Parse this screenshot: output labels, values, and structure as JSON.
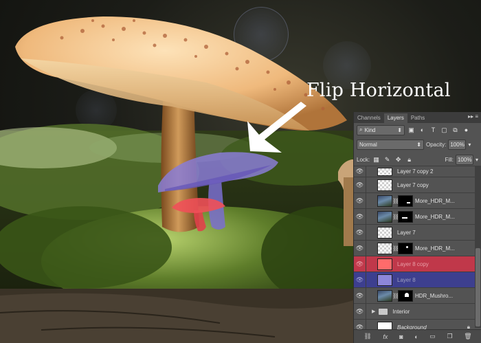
{
  "annotation": {
    "text": "Flip Horizontal"
  },
  "panel": {
    "tabs": [
      {
        "label": "Channels",
        "active": false
      },
      {
        "label": "Layers",
        "active": true
      },
      {
        "label": "Paths",
        "active": false
      }
    ],
    "filter": {
      "kind_label": "Kind"
    },
    "blend": {
      "mode": "Normal",
      "opacity_label": "Opacity:",
      "opacity_value": "100%"
    },
    "lock": {
      "label": "Lock:",
      "fill_label": "Fill:",
      "fill_value": "100%"
    },
    "layers": [
      {
        "name": "Layer 7 copy 2",
        "thumb": "checker",
        "mask": false,
        "style": "normal"
      },
      {
        "name": "Layer 7 copy",
        "thumb": "checker",
        "mask": false,
        "style": "normal"
      },
      {
        "name": "More_HDR_M...",
        "thumb": "photo",
        "mask": true,
        "style": "normal"
      },
      {
        "name": "More_HDR_M...",
        "thumb": "photo",
        "mask": true,
        "style": "normal"
      },
      {
        "name": "Layer 7",
        "thumb": "checker",
        "mask": false,
        "style": "normal"
      },
      {
        "name": "More_HDR_M...",
        "thumb": "checker",
        "mask": true,
        "style": "normal"
      },
      {
        "name": "Layer 8 copy",
        "thumb": "redt",
        "mask": false,
        "style": "red"
      },
      {
        "name": "Layer 8",
        "thumb": "bluet",
        "mask": false,
        "style": "blue"
      },
      {
        "name": "HDR_Mushro...",
        "thumb": "photo",
        "mask": true,
        "style": "normal"
      },
      {
        "name": "Interior",
        "thumb": "folder",
        "mask": false,
        "style": "group"
      },
      {
        "name": "Background",
        "thumb": "white",
        "mask": false,
        "style": "background"
      }
    ],
    "bottom_icons": [
      "link-icon",
      "fx-icon",
      "mask-icon",
      "adjustment-icon",
      "folder-icon",
      "new-layer-icon",
      "trash-icon"
    ]
  }
}
